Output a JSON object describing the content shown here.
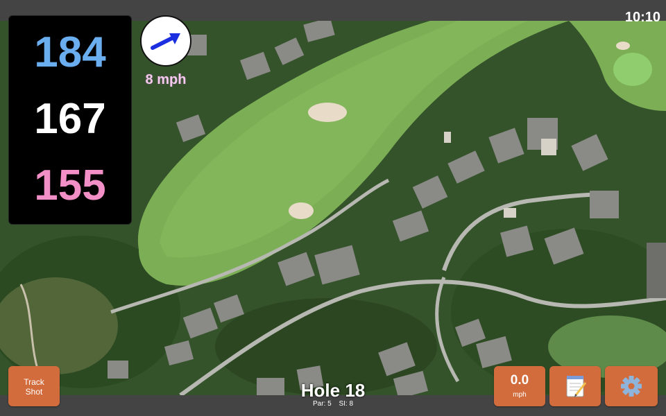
{
  "status": {
    "time": "10:10"
  },
  "distances": {
    "back": "184",
    "middle": "167",
    "front": "155"
  },
  "wind": {
    "speed": "8 mph",
    "direction_icon": "wind-arrow-icon"
  },
  "hole": {
    "title": "Hole 18",
    "par": "Par: 5",
    "si": "SI: 8"
  },
  "buttons": {
    "track_shot_line1": "Track",
    "track_shot_line2": "Shot",
    "speed_value": "0.0",
    "speed_unit": "mph",
    "notes_icon": "notepad-icon",
    "settings_icon": "gear-icon"
  },
  "colors": {
    "back": "#6aaef0",
    "middle": "#ffffff",
    "front": "#f28fc6",
    "button": "#d26c3c",
    "wind_label": "#f7c9ef"
  }
}
